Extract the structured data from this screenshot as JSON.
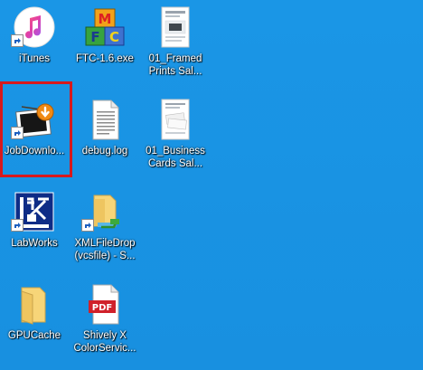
{
  "desktop": {
    "icons": [
      {
        "label": "iTunes",
        "icon": "itunes-icon",
        "shortcut": true
      },
      {
        "label": "FTC-1.6.exe",
        "icon": "ftc-app-icon",
        "shortcut": false
      },
      {
        "label": "01_Framed Prints Sal...",
        "icon": "document-thumbnail-icon",
        "shortcut": false
      },
      {
        "label": "JobDownlo...",
        "icon": "job-downloader-icon",
        "shortcut": true
      },
      {
        "label": "debug.log",
        "icon": "text-file-icon",
        "shortcut": false
      },
      {
        "label": "01_Business Cards Sal...",
        "icon": "document-thumbnail-icon",
        "shortcut": false
      },
      {
        "label": "LabWorks",
        "icon": "labworks-icon",
        "shortcut": true
      },
      {
        "label": "XMLFileDrop (vcsfile) - S...",
        "icon": "folder-network-icon",
        "shortcut": true
      },
      {
        "label": "GPUCache",
        "icon": "folder-icon",
        "shortcut": false
      },
      {
        "label": "Shively X ColorServic...",
        "icon": "pdf-icon",
        "shortcut": false
      }
    ],
    "pdf_badge_text": "PDF",
    "ftc_letters": [
      "M",
      "F",
      "C"
    ],
    "colors": {
      "background": "#1a94e4",
      "selection": "#d7191c",
      "label_text": "#ffffff"
    }
  }
}
